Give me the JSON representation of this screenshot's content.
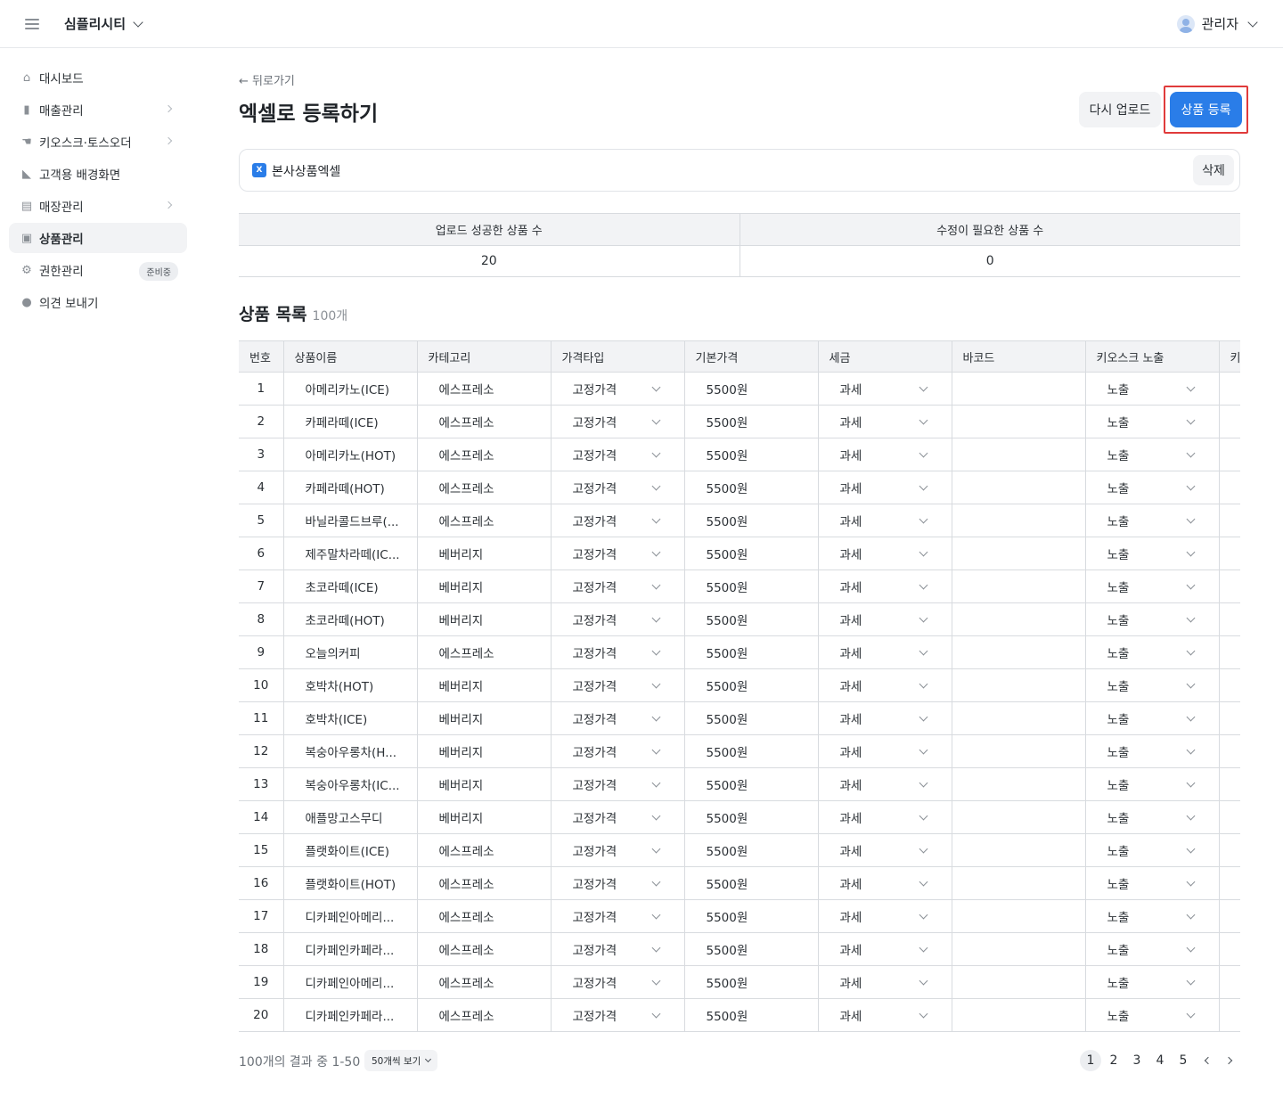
{
  "header": {
    "brand": "심플리시티",
    "user": "관리자"
  },
  "sidebar": {
    "items": [
      {
        "label": "대시보드",
        "icon": "home-icon",
        "glyph": "⌂",
        "has_children": false
      },
      {
        "label": "매출관리",
        "icon": "bar-chart-icon",
        "glyph": "▮",
        "has_children": true
      },
      {
        "label": "키오스크·토스오더",
        "icon": "hand-pointer-icon",
        "glyph": "☚",
        "has_children": true
      },
      {
        "label": "고객용 배경화면",
        "icon": "brush-icon",
        "glyph": "◣",
        "has_children": false
      },
      {
        "label": "매장관리",
        "icon": "store-icon",
        "glyph": "▤",
        "has_children": true
      },
      {
        "label": "상품관리",
        "icon": "ticket-icon",
        "glyph": "▣",
        "has_children": false,
        "active": true
      },
      {
        "label": "권한관리",
        "icon": "gear-icon",
        "glyph": "⚙",
        "has_children": false,
        "badge": "준비중"
      },
      {
        "label": "의견 보내기",
        "icon": "chat-bubble-icon",
        "glyph": "●",
        "has_children": false
      }
    ]
  },
  "page": {
    "back": "← 뒤로가기",
    "title": "엑셀로 등록하기",
    "reupload_label": "다시 업로드",
    "register_label": "상품 등록"
  },
  "file": {
    "name": "본사상품엑셀",
    "delete_label": "삭제",
    "icon_text": "X"
  },
  "summary": {
    "headers": [
      "업로드 성공한 상품 수",
      "수정이 필요한 상품 수"
    ],
    "values": [
      "20",
      "0"
    ]
  },
  "list": {
    "title": "상품 목록",
    "count": "100개",
    "columns": [
      "번호",
      "상품이름",
      "카테고리",
      "가격타입",
      "기본가격",
      "세금",
      "바코드",
      "키오스크 노출",
      "키"
    ],
    "rows": [
      [
        "1",
        "아메리카노(ICE)",
        "에스프레소",
        "고정가격",
        "5500원",
        "과세",
        "",
        "노출"
      ],
      [
        "2",
        "카페라떼(ICE)",
        "에스프레소",
        "고정가격",
        "5500원",
        "과세",
        "",
        "노출"
      ],
      [
        "3",
        "아메리카노(HOT)",
        "에스프레소",
        "고정가격",
        "5500원",
        "과세",
        "",
        "노출"
      ],
      [
        "4",
        "카페라떼(HOT)",
        "에스프레소",
        "고정가격",
        "5500원",
        "과세",
        "",
        "노출"
      ],
      [
        "5",
        "바닐라콜드브루(...",
        "에스프레소",
        "고정가격",
        "5500원",
        "과세",
        "",
        "노출"
      ],
      [
        "6",
        "제주말차라떼(IC...",
        "베버리지",
        "고정가격",
        "5500원",
        "과세",
        "",
        "노출"
      ],
      [
        "7",
        "초코라떼(ICE)",
        "베버리지",
        "고정가격",
        "5500원",
        "과세",
        "",
        "노출"
      ],
      [
        "8",
        "초코라떼(HOT)",
        "베버리지",
        "고정가격",
        "5500원",
        "과세",
        "",
        "노출"
      ],
      [
        "9",
        "오늘의커피",
        "에스프레소",
        "고정가격",
        "5500원",
        "과세",
        "",
        "노출"
      ],
      [
        "10",
        "호박차(HOT)",
        "베버리지",
        "고정가격",
        "5500원",
        "과세",
        "",
        "노출"
      ],
      [
        "11",
        "호박차(ICE)",
        "베버리지",
        "고정가격",
        "5500원",
        "과세",
        "",
        "노출"
      ],
      [
        "12",
        "복숭아우롱차(H...",
        "베버리지",
        "고정가격",
        "5500원",
        "과세",
        "",
        "노출"
      ],
      [
        "13",
        "복숭아우롱차(IC...",
        "베버리지",
        "고정가격",
        "5500원",
        "과세",
        "",
        "노출"
      ],
      [
        "14",
        "애플망고스무디",
        "베버리지",
        "고정가격",
        "5500원",
        "과세",
        "",
        "노출"
      ],
      [
        "15",
        "플랫화이트(ICE)",
        "에스프레소",
        "고정가격",
        "5500원",
        "과세",
        "",
        "노출"
      ],
      [
        "16",
        "플랫화이트(HOT)",
        "에스프레소",
        "고정가격",
        "5500원",
        "과세",
        "",
        "노출"
      ],
      [
        "17",
        "디카페인아메리...",
        "에스프레소",
        "고정가격",
        "5500원",
        "과세",
        "",
        "노출"
      ],
      [
        "18",
        "디카페인카페라...",
        "에스프레소",
        "고정가격",
        "5500원",
        "과세",
        "",
        "노출"
      ],
      [
        "19",
        "디카페인아메리...",
        "에스프레소",
        "고정가격",
        "5500원",
        "과세",
        "",
        "노출"
      ],
      [
        "20",
        "디카페인카페라...",
        "에스프레소",
        "고정가격",
        "5500원",
        "과세",
        "",
        "노출"
      ]
    ]
  },
  "footer": {
    "result_text": "100개의 결과 중 1-50",
    "per_page": "50개씩 보기",
    "pages": [
      "1",
      "2",
      "3",
      "4",
      "5"
    ],
    "current_page": "1"
  },
  "colors": {
    "accent": "#2a7de8",
    "highlight": "#e03b3b",
    "muted_bg": "#f2f3f5"
  }
}
